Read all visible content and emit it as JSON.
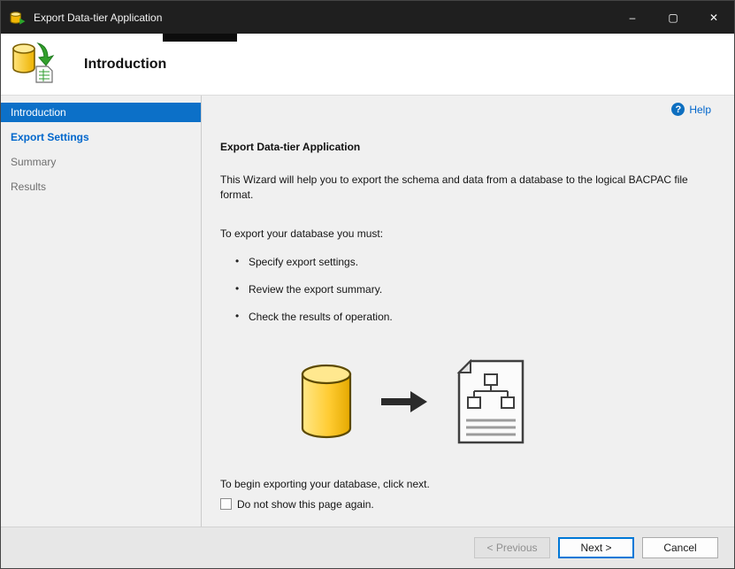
{
  "window": {
    "title": "Export Data-tier Application",
    "controls": {
      "minimize": "–",
      "maximize": "▢",
      "close": "✕"
    }
  },
  "header": {
    "title": "Introduction"
  },
  "sidebar": {
    "items": [
      {
        "label": "Introduction",
        "state": "active"
      },
      {
        "label": "Export Settings",
        "state": "link"
      },
      {
        "label": "Summary",
        "state": "disabled"
      },
      {
        "label": "Results",
        "state": "disabled"
      }
    ]
  },
  "content": {
    "help_label": "Help",
    "help_glyph": "?",
    "heading": "Export Data-tier Application",
    "intro": "This Wizard will help you to export the schema and data from a database to the logical BACPAC file format.",
    "must_label": "To export your database you must:",
    "bullets": [
      "Specify export settings.",
      "Review the export summary.",
      "Check the results of operation."
    ],
    "begin_text": "To begin exporting your database, click next.",
    "checkbox": {
      "label": "Do not show this page again.",
      "checked": false
    }
  },
  "footer": {
    "previous_label": "< Previous",
    "next_label": "Next >",
    "cancel_label": "Cancel"
  },
  "colors": {
    "accent": "#0c70c8",
    "link": "#0066cc",
    "titlebar": "#1f1f1f",
    "database_yellow": "#ffcc33",
    "arrow_green": "#33a02c"
  }
}
